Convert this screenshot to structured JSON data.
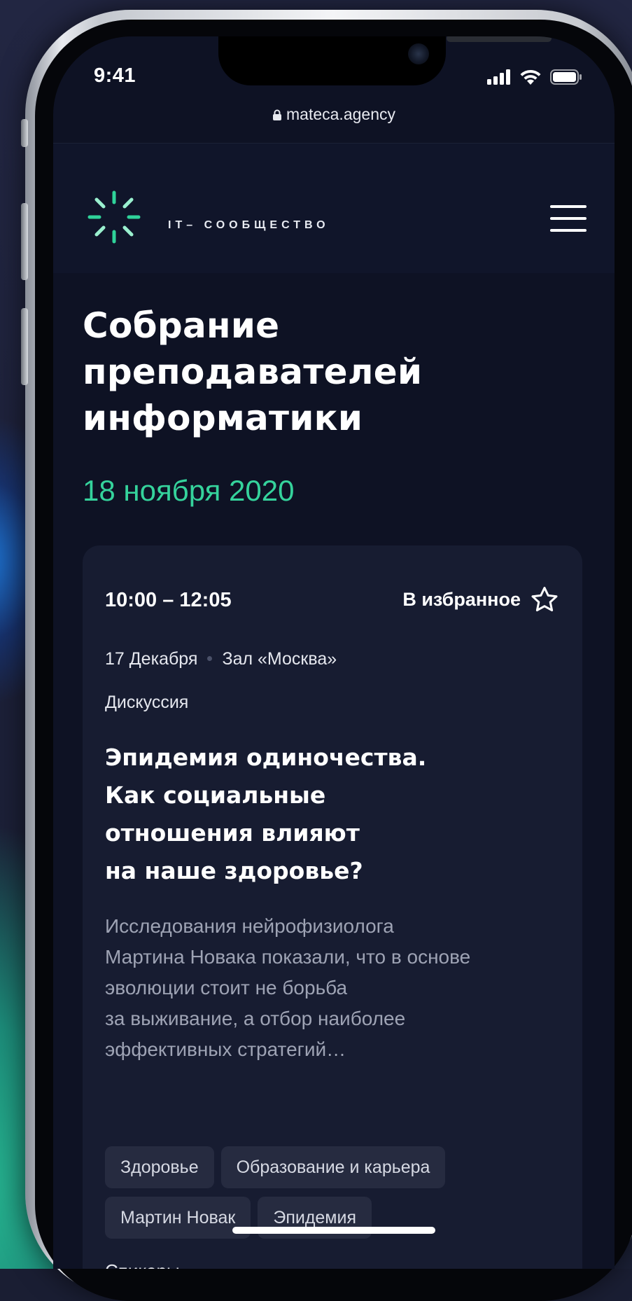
{
  "status_bar": {
    "time": "9:41"
  },
  "browser": {
    "url": "mateca.agency"
  },
  "header": {
    "logo_text": "IT– СООБЩЕСТВО"
  },
  "page": {
    "title_lines": [
      "Собрание",
      "преподавателей",
      "информатики"
    ],
    "date": "18 ноября 2020"
  },
  "event": {
    "time": "10:00 – 12:05",
    "favorite_label": "В избранное",
    "day": "17 Декабря",
    "hall": "Зал «Москва»",
    "kind": "Дискуссия",
    "title_lines": [
      "Эпидемия одиночества.",
      "Как социальные",
      "отношения влияют",
      "на наше здоровье?"
    ],
    "description_lines": [
      "Исследования нейрофизиолога",
      "Мартина Новака показали, что в основе",
      "эволюции стоит не борьба",
      "за выживание, а отбор наиболее",
      "эффективных стратегий…"
    ],
    "tags": [
      "Здоровье",
      "Образование и карьера",
      "Мартин Новак",
      "Эпидемия"
    ],
    "speakers_label": "Спикеры"
  },
  "colors": {
    "accent": "#35d39c",
    "background": "#0e1224",
    "card": "#171c31",
    "tag": "#262b40"
  }
}
